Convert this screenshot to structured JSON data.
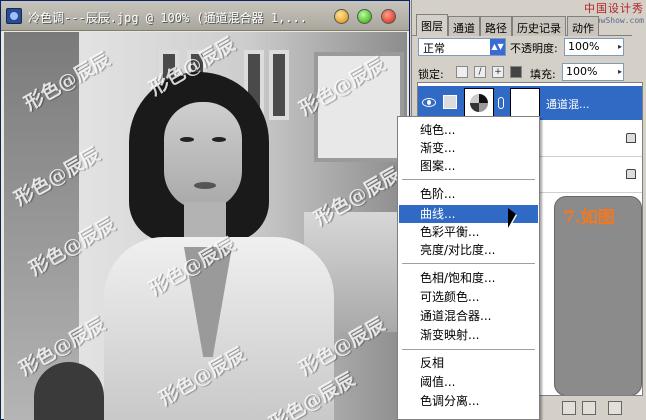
{
  "document": {
    "title": "冷色调---辰辰.jpg @ 100% (通道混合器 1,..."
  },
  "watermarks": [
    "形色@辰辰",
    "形色@辰辰",
    "形色@辰辰",
    "形色@辰辰",
    "形色@辰辰",
    "形色@辰辰",
    "形色@辰辰",
    "形色@辰辰",
    "形色@辰辰",
    "形色@辰辰",
    "形色@辰辰"
  ],
  "layers_panel": {
    "tabs": [
      "图层",
      "通道",
      "路径",
      "历史记录",
      "动作"
    ],
    "site_logo": {
      "cn": "中国设计秀",
      "en": "www.ShowShow.com"
    },
    "blend_mode": "正常",
    "opacity_label": "不透明度:",
    "opacity_value": "100%",
    "lock_label": "锁定:",
    "fill_label": "填充:",
    "fill_value": "100%",
    "selected_layer_name": "通道混...",
    "annotation": "7.如图"
  },
  "context_menu": {
    "items": [
      "纯色...",
      "渐变...",
      "图案...",
      "色阶...",
      "曲线...",
      "色彩平衡...",
      "亮度/对比度...",
      "色相/饱和度...",
      "可选颜色...",
      "通道混合器...",
      "渐变映射...",
      "反相",
      "阈值...",
      "色调分离..."
    ],
    "highlighted": "曲线..."
  },
  "colors": {
    "selection_blue": "#316ac5",
    "annotation_orange": "#f47820",
    "panel_bg": "#d4d0c8"
  }
}
